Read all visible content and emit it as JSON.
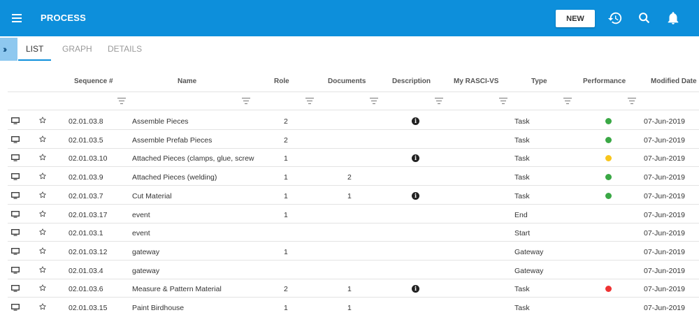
{
  "app": {
    "title": "PROCESS",
    "new_label": "NEW"
  },
  "tabs": [
    {
      "label": "LIST",
      "active": true
    },
    {
      "label": "GRAPH",
      "active": false
    },
    {
      "label": "DETAILS",
      "active": false
    }
  ],
  "columns": [
    "Sequence #",
    "Name",
    "Role",
    "Documents",
    "Description",
    "My RASCI-VS",
    "Type",
    "Performance",
    "Modified Date"
  ],
  "colors": {
    "accent": "#0d8fdb",
    "green": "#3aa845",
    "yellow": "#f8c51c",
    "red": "#ee3333",
    "expander": "#8ec8ef"
  },
  "icons": {
    "menu": "menu-icon",
    "history": "history-icon",
    "search": "search-icon",
    "bell": "bell-icon",
    "monitor": "monitor-icon",
    "star": "star-outline-icon",
    "info": "info-icon",
    "filter": "filter-icon",
    "expand": "double-chevron-right-icon"
  },
  "rows": [
    {
      "seq": "02.01.03.8",
      "name": "Assemble Pieces",
      "role": "2",
      "docs": "",
      "info": true,
      "type": "Task",
      "perf": "green",
      "date": "07-Jun-2019"
    },
    {
      "seq": "02.01.03.5",
      "name": "Assemble Prefab Pieces",
      "role": "2",
      "docs": "",
      "info": false,
      "type": "Task",
      "perf": "green",
      "date": "07-Jun-2019"
    },
    {
      "seq": "02.01.03.10",
      "name": "Attached Pieces (clamps, glue, screw",
      "role": "1",
      "docs": "",
      "info": true,
      "type": "Task",
      "perf": "yellow",
      "date": "07-Jun-2019"
    },
    {
      "seq": "02.01.03.9",
      "name": "Attached Pieces (welding)",
      "role": "1",
      "docs": "2",
      "info": false,
      "type": "Task",
      "perf": "green",
      "date": "07-Jun-2019"
    },
    {
      "seq": "02.01.03.7",
      "name": "Cut Material",
      "role": "1",
      "docs": "1",
      "info": true,
      "type": "Task",
      "perf": "green",
      "date": "07-Jun-2019"
    },
    {
      "seq": "02.01.03.17",
      "name": "event",
      "role": "1",
      "docs": "",
      "info": false,
      "type": "End",
      "perf": "",
      "date": "07-Jun-2019"
    },
    {
      "seq": "02.01.03.1",
      "name": "event",
      "role": "",
      "docs": "",
      "info": false,
      "type": "Start",
      "perf": "",
      "date": "07-Jun-2019"
    },
    {
      "seq": "02.01.03.12",
      "name": "gateway",
      "role": "1",
      "docs": "",
      "info": false,
      "type": "Gateway",
      "perf": "",
      "date": "07-Jun-2019"
    },
    {
      "seq": "02.01.03.4",
      "name": "gateway",
      "role": "",
      "docs": "",
      "info": false,
      "type": "Gateway",
      "perf": "",
      "date": "07-Jun-2019"
    },
    {
      "seq": "02.01.03.6",
      "name": "Measure & Pattern Material",
      "role": "2",
      "docs": "1",
      "info": true,
      "type": "Task",
      "perf": "red",
      "date": "07-Jun-2019"
    },
    {
      "seq": "02.01.03.15",
      "name": "Paint Birdhouse",
      "role": "1",
      "docs": "1",
      "info": false,
      "type": "Task",
      "perf": "",
      "date": "07-Jun-2019"
    }
  ]
}
